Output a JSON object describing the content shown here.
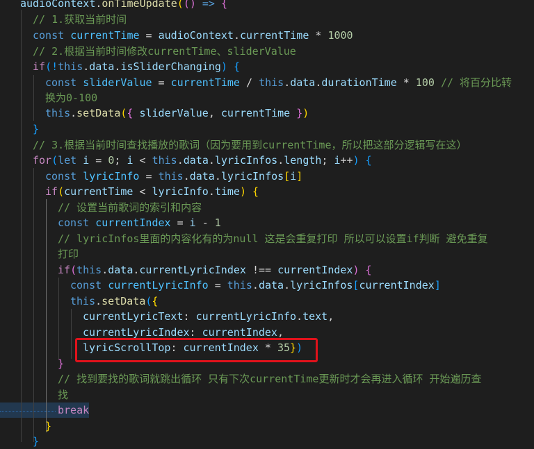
{
  "editor": {
    "language": "javascript",
    "theme_colors": {
      "background": "#1e1e1e",
      "keyword": "#569cd6",
      "control": "#c586c0",
      "variable": "#9cdcfe",
      "function": "#dcdcaa",
      "number": "#b5cea8",
      "comment": "#6a9955",
      "highlight_box": "#e0121b"
    },
    "lines": {
      "l1": [
        "audioContext",
        ".",
        "onTimeUpdate",
        "(",
        "()",
        " => ",
        "{"
      ],
      "l2": "// 1.获取当前时间",
      "l3": [
        "const",
        " ",
        "currentTime",
        " = ",
        "audioContext",
        ".",
        "currentTime",
        " * ",
        "1000"
      ],
      "l4": "// 2.根据当前时间修改currentTime、sliderValue",
      "l5": [
        "if",
        "(!",
        "this",
        ".",
        "data",
        ".",
        "isSliderChanging",
        ") ",
        "{"
      ],
      "l6": [
        "const",
        " ",
        "sliderValue",
        " = ",
        "currentTime",
        " / ",
        "this",
        ".",
        "data",
        ".",
        "durationTime",
        " * ",
        "100",
        " ",
        "// 将百分比转"
      ],
      "l7": "换为0-100",
      "l8": [
        "this",
        ".",
        "setData",
        "(",
        "{",
        " ",
        "sliderValue",
        ", ",
        "currentTime",
        " ",
        "}",
        ")"
      ],
      "l9": "}",
      "l10": "// 3.根据当前时间查找播放的歌词（因为要用到currentTime，所以把这部分逻辑写在这）",
      "l11": [
        "for",
        "(",
        "let",
        " ",
        "i",
        " = ",
        "0",
        "; ",
        "i",
        " < ",
        "this",
        ".",
        "data",
        ".",
        "lyricInfos",
        ".",
        "length",
        "; ",
        "i",
        "++",
        ") ",
        "{"
      ],
      "l12": [
        "const",
        " ",
        "lyricInfo",
        " = ",
        "this",
        ".",
        "data",
        ".",
        "lyricInfos",
        "[",
        "i",
        "]"
      ],
      "l13": [
        "if",
        "(",
        "currentTime",
        " < ",
        "lyricInfo",
        ".",
        "time",
        ") ",
        "{"
      ],
      "l14": "// 设置当前歌词的索引和内容",
      "l15": [
        "const",
        " ",
        "currentIndex",
        " = ",
        "i",
        " - ",
        "1"
      ],
      "l16": "// lyricInfos里面的内容化有的为null 这是会重复打印 所以可以设置if判断 避免重复",
      "l17": "打印",
      "l18": [
        "if",
        "(",
        "this",
        ".",
        "data",
        ".",
        "currentLyricIndex",
        " !== ",
        "currentIndex",
        ") ",
        "{"
      ],
      "l19": [
        "const",
        " ",
        "currentLyricInfo",
        " = ",
        "this",
        ".",
        "data",
        ".",
        "lyricInfos",
        "[",
        "currentIndex",
        "]"
      ],
      "l20": [
        "this",
        ".",
        "setData",
        "(",
        "{"
      ],
      "l21": [
        "currentLyricText",
        ": ",
        "currentLyricInfo",
        ".",
        "text",
        ","
      ],
      "l22": [
        "currentLyricIndex",
        ": ",
        "currentIndex",
        ","
      ],
      "l23": [
        "lyricScrollTop",
        ": ",
        "currentIndex",
        " * ",
        "35",
        "}",
        ")"
      ],
      "l24": "}",
      "l25": "// 找到要找的歌词就跳出循环 只有下次currentTime更新时才会再进入循环 开始遍历查",
      "l26": "找",
      "l27": "break",
      "l28": "}",
      "l29": "}"
    }
  }
}
